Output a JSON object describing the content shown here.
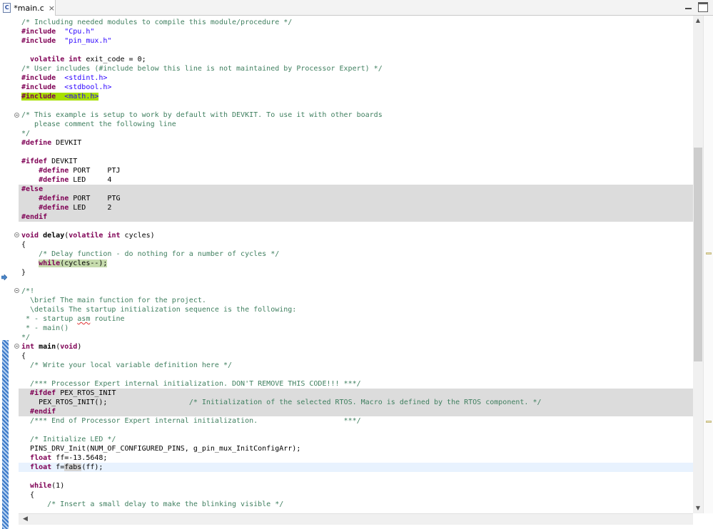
{
  "tab": {
    "title": "*main.c",
    "file_icon": "C",
    "close_glyph": "×"
  },
  "window_controls": {
    "minimize": "minimize-icon",
    "maximize": "maximize-icon"
  },
  "scroll": {
    "up_glyph": "▲",
    "down_glyph": "▼",
    "left_glyph": "◀"
  },
  "code": [
    [
      [
        "cm",
        "/* Including needed modules to compile this module/procedure */"
      ]
    ],
    [
      [
        "pp",
        "#include"
      ],
      [
        "",
        "  "
      ],
      [
        "str",
        "\"Cpu.h\""
      ]
    ],
    [
      [
        "pp",
        "#include"
      ],
      [
        "",
        "  "
      ],
      [
        "str",
        "\"pin_mux.h\""
      ]
    ],
    [],
    [
      [
        "",
        "  "
      ],
      [
        "kw",
        "volatile"
      ],
      [
        "",
        " "
      ],
      [
        "kw",
        "int"
      ],
      [
        "",
        " exit_code = 0;"
      ]
    ],
    [
      [
        "cm",
        "/* User includes (#include below this line is not maintained by Processor Expert) */"
      ]
    ],
    [
      [
        "pp",
        "#include"
      ],
      [
        "",
        "  "
      ],
      [
        "str",
        "<stdint.h>"
      ]
    ],
    [
      [
        "pp",
        "#include"
      ],
      [
        "",
        "  "
      ],
      [
        "str",
        "<stdbool.h>"
      ]
    ],
    [
      [
        "hl-green pp",
        "#include"
      ],
      [
        "hl-green",
        "  "
      ],
      [
        "hl-green str",
        "<math.h>"
      ]
    ],
    [],
    [
      [
        "cm",
        "/* This example is setup to work by default with DEVKIT. To use it with other boards"
      ]
    ],
    [
      [
        "cm",
        "   please comment the following line"
      ]
    ],
    [
      [
        "cm",
        "*/"
      ]
    ],
    [
      [
        "pp",
        "#define"
      ],
      [
        "",
        " DEVKIT"
      ]
    ],
    [],
    [
      [
        "pp",
        "#ifdef"
      ],
      [
        "",
        " DEVKIT"
      ]
    ],
    [
      [
        "",
        "    "
      ],
      [
        "pp",
        "#define"
      ],
      [
        "",
        " PORT    PTJ"
      ]
    ],
    [
      [
        "",
        "    "
      ],
      [
        "pp",
        "#define"
      ],
      [
        "",
        " LED     4"
      ]
    ],
    [
      [
        "pp",
        "#else"
      ]
    ],
    [
      [
        "",
        "    "
      ],
      [
        "pp",
        "#define"
      ],
      [
        "",
        " PORT    PTG"
      ]
    ],
    [
      [
        "",
        "    "
      ],
      [
        "pp",
        "#define"
      ],
      [
        "",
        " LED     2"
      ]
    ],
    [
      [
        "pp",
        "#endif"
      ]
    ],
    [],
    [
      [
        "kw",
        "void"
      ],
      [
        "",
        " "
      ],
      [
        "fn",
        "delay"
      ],
      [
        "",
        "("
      ],
      [
        "kw",
        "volatile"
      ],
      [
        "",
        " "
      ],
      [
        "kw",
        "int"
      ],
      [
        "",
        " cycles)"
      ]
    ],
    [
      [
        "",
        "{"
      ]
    ],
    [
      [
        "",
        "    "
      ],
      [
        "cm",
        "/* Delay function - do nothing for a number of cycles */"
      ]
    ],
    [
      [
        "",
        "    "
      ],
      [
        "hl-dbg kw",
        "while"
      ],
      [
        "hl-dbg",
        "(cycles--);"
      ]
    ],
    [
      [
        "",
        "}"
      ]
    ],
    [],
    [
      [
        "cm",
        "/*!"
      ]
    ],
    [
      [
        "cm",
        "  \\brief The main function for the project."
      ]
    ],
    [
      [
        "cm",
        "  \\details The startup initialization sequence is the following:"
      ]
    ],
    [
      [
        "cm",
        " * - startup "
      ],
      [
        "cm squig",
        "asm"
      ],
      [
        "cm",
        " routine"
      ]
    ],
    [
      [
        "cm",
        " * - main()"
      ]
    ],
    [
      [
        "cm",
        "*/"
      ]
    ],
    [
      [
        "kw",
        "int"
      ],
      [
        "",
        " "
      ],
      [
        "fn",
        "main"
      ],
      [
        "",
        "("
      ],
      [
        "kw",
        "void"
      ],
      [
        "",
        ")"
      ]
    ],
    [
      [
        "",
        "{"
      ]
    ],
    [
      [
        "",
        "  "
      ],
      [
        "cm",
        "/* Write your local variable definition here */"
      ]
    ],
    [],
    [
      [
        "",
        "  "
      ],
      [
        "cm",
        "/*** Processor Expert internal initialization. DON'T REMOVE THIS CODE!!! ***/"
      ]
    ],
    [
      [
        "",
        "  "
      ],
      [
        "pp",
        "#ifdef"
      ],
      [
        "",
        " PEX_RTOS_INIT"
      ]
    ],
    [
      [
        "",
        "    PEX_RTOS_INIT();                   "
      ],
      [
        "cm",
        "/* Initialization of the selected RTOS. Macro is defined by the RTOS component. */"
      ]
    ],
    [
      [
        "",
        "  "
      ],
      [
        "pp",
        "#endif"
      ]
    ],
    [
      [
        "",
        "  "
      ],
      [
        "cm",
        "/*** End of Processor Expert internal initialization.                    ***/"
      ]
    ],
    [],
    [
      [
        "",
        "  "
      ],
      [
        "cm",
        "/* Initialize LED */"
      ]
    ],
    [
      [
        "",
        "  PINS_DRV_Init(NUM_OF_CONFIGURED_PINS, g_pin_mux_InitConfigArr);"
      ]
    ],
    [
      [
        "",
        "  "
      ],
      [
        "kw",
        "float"
      ],
      [
        "",
        " ff=-13.5648;"
      ]
    ],
    [
      [
        "",
        "  "
      ],
      [
        "kw",
        "float"
      ],
      [
        "",
        " f="
      ],
      [
        "occ",
        "fabs"
      ],
      [
        "",
        "(ff);"
      ]
    ],
    [],
    [
      [
        "",
        "  "
      ],
      [
        "kw",
        "while"
      ],
      [
        "",
        "(1)"
      ]
    ],
    [
      [
        "",
        "  {"
      ]
    ],
    [
      [
        "",
        "      "
      ],
      [
        "cm",
        "/* Insert a small delay to make the blinking visible */"
      ]
    ]
  ]
}
